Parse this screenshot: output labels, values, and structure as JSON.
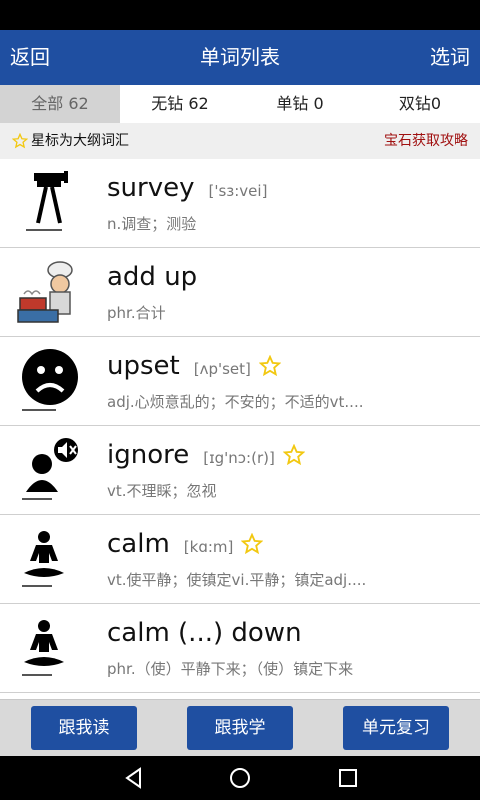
{
  "header": {
    "back_label": "返回",
    "title": "单词列表",
    "select_label": "选词"
  },
  "tabs": [
    {
      "label": "全部 62"
    },
    {
      "label": "无钻 62"
    },
    {
      "label": "单钻 0"
    },
    {
      "label": "双钻0"
    }
  ],
  "hint": {
    "star_note": "星标为大纲词汇",
    "gem_guide": "宝石获取攻略"
  },
  "colors": {
    "brand": "#1f4fa1",
    "accent_red": "#a01010",
    "star": "#f2c811"
  },
  "words": [
    {
      "word": "survey",
      "phonetic": "['sɜ:vei]",
      "meaning": "n.调查；测验",
      "starred": false,
      "icon": "tripod-icon"
    },
    {
      "word": "add up",
      "phonetic": "",
      "meaning": "phr.合计",
      "starred": false,
      "icon": "chef-cartoon-icon"
    },
    {
      "word": "upset",
      "phonetic": "[ʌp'set]",
      "meaning": "adj.心烦意乱的；不安的；不适的vt....",
      "starred": true,
      "icon": "sad-face-icon"
    },
    {
      "word": "ignore",
      "phonetic": "[ɪg'nɔ:(r)]",
      "meaning": "vt.不理睬；忽视",
      "starred": true,
      "icon": "mute-person-icon"
    },
    {
      "word": "calm",
      "phonetic": "[kɑ:m]",
      "meaning": "vt.使平静；使镇定vi.平静；镇定adj....",
      "starred": true,
      "icon": "meditation-icon"
    },
    {
      "word": "calm (...) down",
      "phonetic": "",
      "meaning": "phr.（使）平静下来；（使）镇定下来",
      "starred": false,
      "icon": "meditation-icon"
    }
  ],
  "footer": {
    "read_label": "跟我读",
    "learn_label": "跟我学",
    "review_label": "单元复习"
  }
}
